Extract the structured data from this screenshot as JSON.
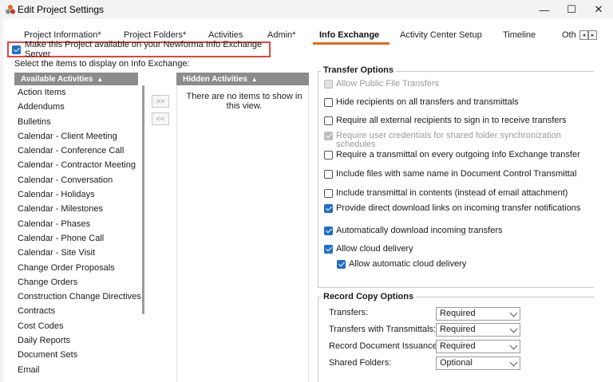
{
  "window": {
    "title": "Edit Project Settings",
    "controls": {
      "minimize": "—",
      "maximize": "☐",
      "close": "✕"
    }
  },
  "tabs": [
    {
      "label": "Project Information*",
      "active": false
    },
    {
      "label": "Project Folders*",
      "active": false
    },
    {
      "label": "Activities",
      "active": false
    },
    {
      "label": "Admin*",
      "active": false
    },
    {
      "label": "Info Exchange",
      "active": true
    },
    {
      "label": "Activity Center Setup",
      "active": false
    },
    {
      "label": "Timeline",
      "active": false
    },
    {
      "label": "Oth",
      "active": false
    }
  ],
  "tab_scroll": {
    "left": "◂",
    "right": "▸"
  },
  "make_available": {
    "label": "Make this Project available on your Newforma Info Exchange Server",
    "checked": true
  },
  "select_label": "Select the items to display on Info Exchange:",
  "available": {
    "header": "Available Activities",
    "sort_glyph": "▲",
    "items": [
      "Action Items",
      "Addendums",
      "Bulletins",
      "Calendar - Client Meeting",
      "Calendar - Conference Call",
      "Calendar - Contractor Meeting",
      "Calendar - Conversation",
      "Calendar - Holidays",
      "Calendar - Milestones",
      "Calendar - Phases",
      "Calendar - Phone Call",
      "Calendar - Site Visit",
      "Change Order Proposals",
      "Change Orders",
      "Construction Change Directives",
      "Contracts",
      "Cost Codes",
      "Daily Reports",
      "Document Sets",
      "Email"
    ]
  },
  "move_buttons": {
    "add": ">>",
    "remove": "<<"
  },
  "hidden": {
    "header": "Hidden Activities",
    "sort_glyph": "▲",
    "empty_text": "There are no items to show in this view."
  },
  "transfer_options": {
    "title": "Transfer Options",
    "options": [
      {
        "label": "Allow Public File Transfers",
        "state": "disabled"
      },
      {
        "label": "Hide recipients on all transfers and transmittals",
        "state": "unchecked"
      },
      {
        "label": "Require all external recipients to sign in to receive transfers",
        "state": "unchecked"
      },
      {
        "label": "Require user credentials for shared folder synchronization schedules",
        "state": "disabled-checked"
      },
      {
        "label": "Require a transmittal on every outgoing Info Exchange transfer",
        "state": "unchecked"
      },
      {
        "label": "Include files with same name in Document Control Transmittal",
        "state": "unchecked"
      },
      {
        "label": "Include transmittal in contents (instead of email attachment)",
        "state": "unchecked"
      },
      {
        "label": "Provide direct download links on incoming transfer notifications",
        "state": "checked"
      },
      {
        "label": "Automatically download incoming transfers",
        "state": "checked"
      },
      {
        "label": "Allow cloud delivery",
        "state": "checked"
      },
      {
        "label": "Allow automatic cloud delivery",
        "state": "checked"
      }
    ]
  },
  "record_copy": {
    "title": "Record Copy Options",
    "rows": [
      {
        "label": "Transfers:",
        "value": "Required"
      },
      {
        "label": "Transfers with Transmittals:",
        "value": "Required"
      },
      {
        "label": "Record Document Issuances:",
        "value": "Required"
      },
      {
        "label": "Shared Folders:",
        "value": "Optional"
      }
    ]
  },
  "colors": {
    "accent": "#e06a1b",
    "highlight_border": "#e0463e",
    "checkbox": "#1f6fc8",
    "list_header": "#8c8c8c"
  }
}
